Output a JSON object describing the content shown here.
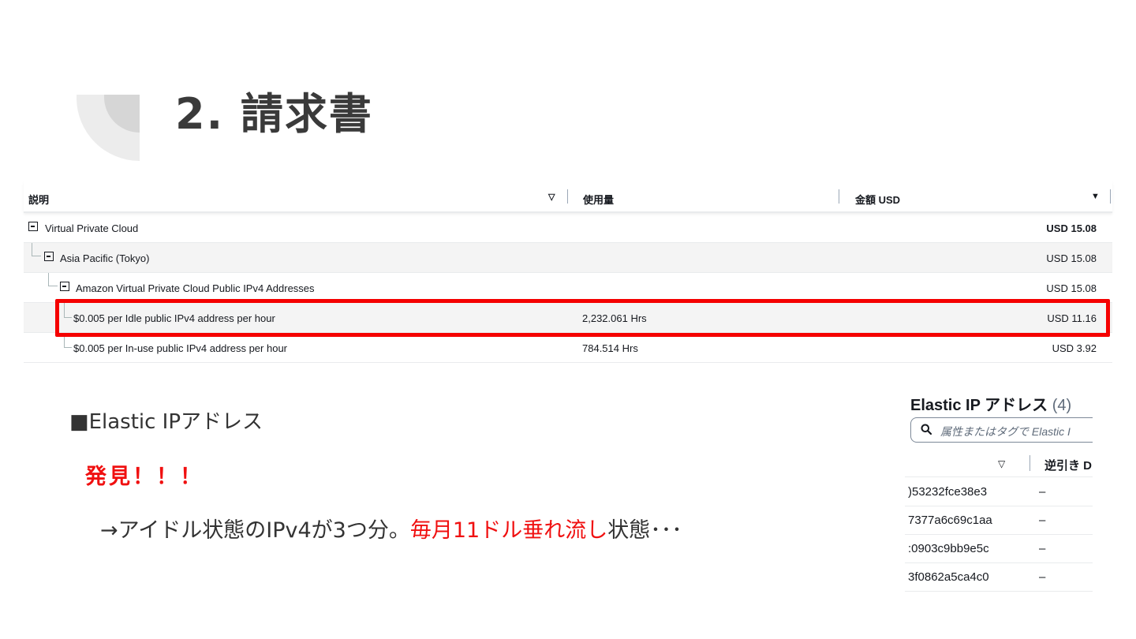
{
  "slide": {
    "title": "2. 請求書"
  },
  "billing": {
    "columns": {
      "description": "説明",
      "usage": "使用量",
      "amount": "金額 USD"
    },
    "rows": [
      {
        "label": "Virtual Private Cloud",
        "usage": "",
        "amount": "USD 15.08"
      },
      {
        "label": "Asia Pacific (Tokyo)",
        "usage": "",
        "amount": "USD 15.08"
      },
      {
        "label": "Amazon Virtual Private Cloud Public IPv4 Addresses",
        "usage": "",
        "amount": "USD 15.08"
      },
      {
        "label": "$0.005 per Idle public IPv4 address per hour",
        "usage": "2,232.061 Hrs",
        "amount": "USD 11.16"
      },
      {
        "label": "$0.005 per In-use public IPv4 address per hour",
        "usage": "784.514 Hrs",
        "amount": "USD 3.92"
      }
    ]
  },
  "notes": {
    "elastic_ip_heading": "■Elastic IPアドレス",
    "found": "発見！！！",
    "message_a": "→アイドル状態のIPv4が3つ分。",
    "message_red": "毎月11ドル垂れ流し",
    "message_b": "状態･･･"
  },
  "eip_panel": {
    "title": "Elastic IP アドレス",
    "count": "(4)",
    "search_placeholder": "属性またはタグで Elastic I",
    "column_label": "逆引き D",
    "rows": [
      {
        "id": ")53232fce38e3",
        "reverse_dns": "–"
      },
      {
        "id": "7377a6c69c1aa",
        "reverse_dns": "–"
      },
      {
        "id": ":0903c9bb9e5c",
        "reverse_dns": "–"
      },
      {
        "id": "3f0862a5ca4c0",
        "reverse_dns": "–"
      }
    ]
  },
  "colors": {
    "highlight": "#f50000",
    "emphasis_red": "#f01010",
    "title_gray": "#3a3a3a"
  }
}
